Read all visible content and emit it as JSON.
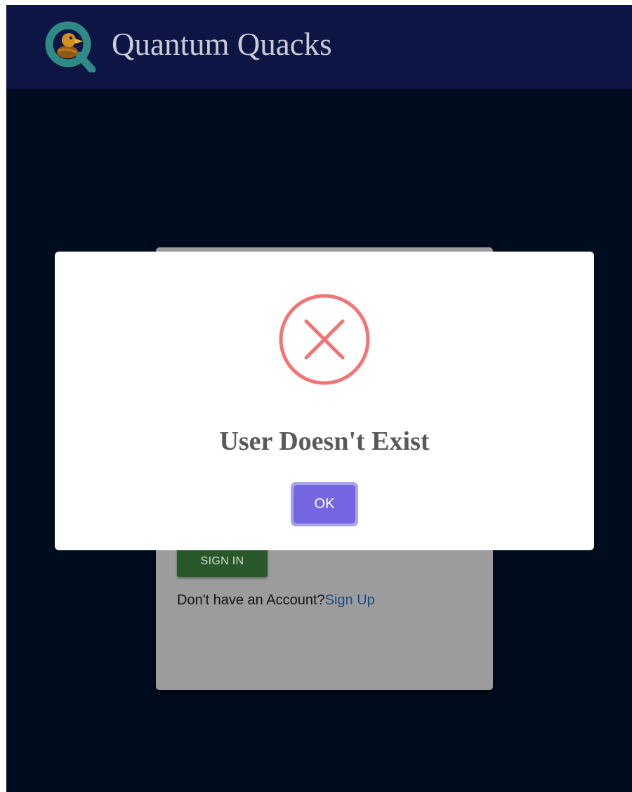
{
  "header": {
    "logo_icon": "quantum-quacks-duck-logo-icon",
    "title": "Quantum Quacks"
  },
  "signin_card": {
    "signin_label": "SIGN IN",
    "no_account_text": "Don't have an Account?",
    "signup_link": "Sign Up"
  },
  "modal": {
    "icon": "error-x-circle-icon",
    "title": "User Doesn't Exist",
    "ok_label": "OK"
  },
  "colors": {
    "header_bg": "#0c1544",
    "page_bg": "#000d1f",
    "card_bg": "#9c9c9c",
    "signin_button": "#29592b",
    "link": "#1d4c83",
    "error_red": "#f27474",
    "ok_button": "#7466e0"
  }
}
